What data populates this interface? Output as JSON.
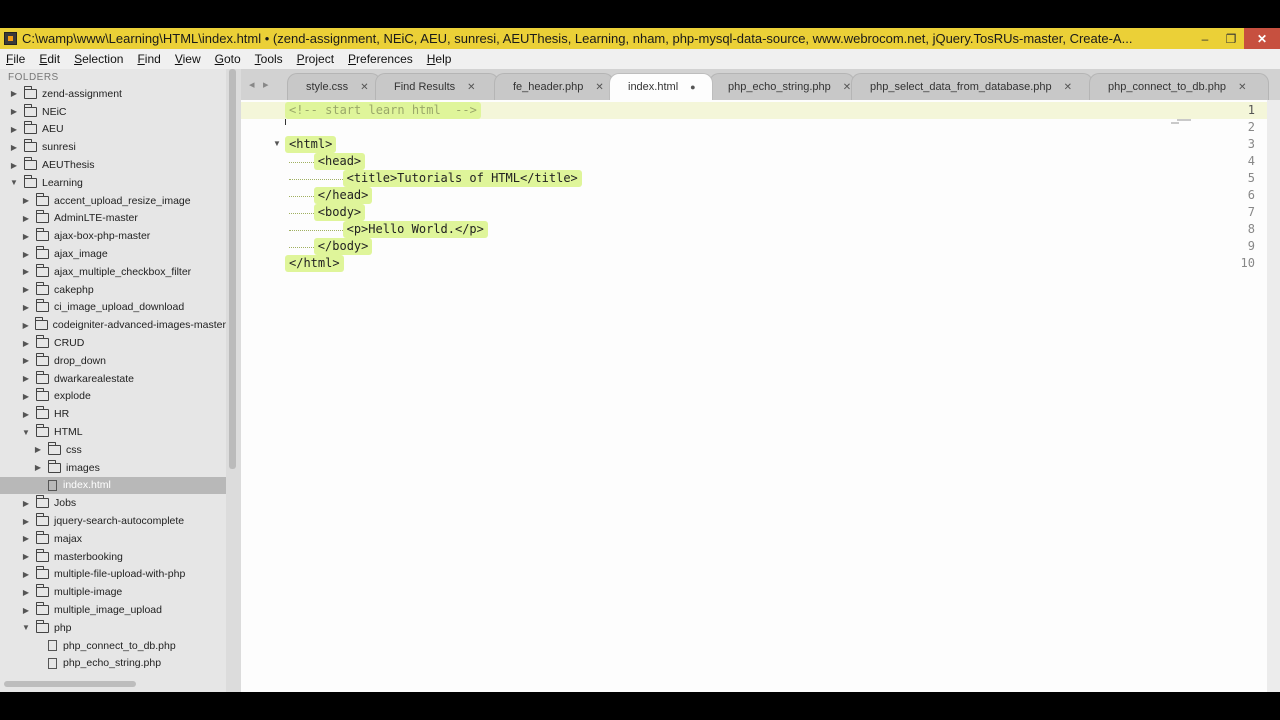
{
  "window": {
    "title": "C:\\wamp\\www\\Learning\\HTML\\index.html • (zend-assignment, NEiC, AEU, sunresi, AEUThesis, Learning, nham, php-mysql-data-source, www.webrocom.net, jQuery.TosRUs-master, Create-A...",
    "controls": {
      "minimize": "–",
      "maximize": "❐",
      "close": "✕"
    },
    "accent_color": "#ebd037"
  },
  "menu": [
    "File",
    "Edit",
    "Selection",
    "Find",
    "View",
    "Goto",
    "Tools",
    "Project",
    "Preferences",
    "Help"
  ],
  "sidebar": {
    "header": "FOLDERS",
    "items": [
      {
        "label": "zend-assignment",
        "depth": 0,
        "kind": "folder",
        "state": "collapsed"
      },
      {
        "label": "NEiC",
        "depth": 0,
        "kind": "folder",
        "state": "collapsed"
      },
      {
        "label": "AEU",
        "depth": 0,
        "kind": "folder",
        "state": "collapsed"
      },
      {
        "label": "sunresi",
        "depth": 0,
        "kind": "folder",
        "state": "collapsed"
      },
      {
        "label": "AEUThesis",
        "depth": 0,
        "kind": "folder",
        "state": "collapsed"
      },
      {
        "label": "Learning",
        "depth": 0,
        "kind": "folder",
        "state": "expanded"
      },
      {
        "label": "accent_upload_resize_image",
        "depth": 1,
        "kind": "folder",
        "state": "collapsed"
      },
      {
        "label": "AdminLTE-master",
        "depth": 1,
        "kind": "folder",
        "state": "collapsed"
      },
      {
        "label": "ajax-box-php-master",
        "depth": 1,
        "kind": "folder",
        "state": "collapsed"
      },
      {
        "label": "ajax_image",
        "depth": 1,
        "kind": "folder",
        "state": "collapsed"
      },
      {
        "label": "ajax_multiple_checkbox_filter",
        "depth": 1,
        "kind": "folder",
        "state": "collapsed"
      },
      {
        "label": "cakephp",
        "depth": 1,
        "kind": "folder",
        "state": "collapsed"
      },
      {
        "label": "ci_image_upload_download",
        "depth": 1,
        "kind": "folder",
        "state": "collapsed"
      },
      {
        "label": "codeigniter-advanced-images-master",
        "depth": 1,
        "kind": "folder",
        "state": "collapsed"
      },
      {
        "label": "CRUD",
        "depth": 1,
        "kind": "folder",
        "state": "collapsed"
      },
      {
        "label": "drop_down",
        "depth": 1,
        "kind": "folder",
        "state": "collapsed"
      },
      {
        "label": "dwarkarealestate",
        "depth": 1,
        "kind": "folder",
        "state": "collapsed"
      },
      {
        "label": "explode",
        "depth": 1,
        "kind": "folder",
        "state": "collapsed"
      },
      {
        "label": "HR",
        "depth": 1,
        "kind": "folder",
        "state": "collapsed"
      },
      {
        "label": "HTML",
        "depth": 1,
        "kind": "folder",
        "state": "expanded"
      },
      {
        "label": "css",
        "depth": 2,
        "kind": "folder",
        "state": "collapsed"
      },
      {
        "label": "images",
        "depth": 2,
        "kind": "folder",
        "state": "collapsed"
      },
      {
        "label": "index.html",
        "depth": 2,
        "kind": "file",
        "state": "selected"
      },
      {
        "label": "Jobs",
        "depth": 1,
        "kind": "folder",
        "state": "collapsed"
      },
      {
        "label": "jquery-search-autocomplete",
        "depth": 1,
        "kind": "folder",
        "state": "collapsed"
      },
      {
        "label": "majax",
        "depth": 1,
        "kind": "folder",
        "state": "collapsed"
      },
      {
        "label": "masterbooking",
        "depth": 1,
        "kind": "folder",
        "state": "collapsed"
      },
      {
        "label": "multiple-file-upload-with-php",
        "depth": 1,
        "kind": "folder",
        "state": "collapsed"
      },
      {
        "label": "multiple-image",
        "depth": 1,
        "kind": "folder",
        "state": "collapsed"
      },
      {
        "label": "multiple_image_upload",
        "depth": 1,
        "kind": "folder",
        "state": "collapsed"
      },
      {
        "label": "php",
        "depth": 1,
        "kind": "folder",
        "state": "expanded"
      },
      {
        "label": "php_connect_to_db.php",
        "depth": 2,
        "kind": "file",
        "state": ""
      },
      {
        "label": "php_echo_string.php",
        "depth": 2,
        "kind": "file",
        "state": ""
      }
    ]
  },
  "tabs": {
    "nav_prev": "◂",
    "nav_next": "▸",
    "items": [
      {
        "label": "style.css",
        "close": "✕",
        "active": false
      },
      {
        "label": "Find Results",
        "close": "✕",
        "active": false
      },
      {
        "label": "fe_header.php",
        "close": "✕",
        "active": false
      },
      {
        "label": "index.html",
        "close": "●",
        "active": true
      },
      {
        "label": "php_echo_string.php",
        "close": "✕",
        "active": false
      },
      {
        "label": "php_select_data_from_database.php",
        "close": "✕",
        "active": false
      },
      {
        "label": "php_connect_to_db.php",
        "close": "✕",
        "active": false
      }
    ]
  },
  "editor": {
    "current_line": 1,
    "lines": [
      {
        "num": "1",
        "text": "<!-- start learn html  -->",
        "indent": 0,
        "comment": true,
        "fold": false
      },
      {
        "num": "2",
        "text": "",
        "indent": 0,
        "comment": false,
        "fold": false
      },
      {
        "num": "3",
        "text": "<html>",
        "indent": 0,
        "comment": false,
        "fold": true
      },
      {
        "num": "4",
        "text": "<head>",
        "indent": 1,
        "comment": false,
        "fold": false
      },
      {
        "num": "5",
        "text": "<title>Tutorials of HTML</title>",
        "indent": 2,
        "comment": false,
        "fold": false
      },
      {
        "num": "6",
        "text": "</head>",
        "indent": 1,
        "comment": false,
        "fold": false
      },
      {
        "num": "7",
        "text": "<body>",
        "indent": 1,
        "comment": false,
        "fold": false
      },
      {
        "num": "8",
        "text": "<p>Hello World.</p>",
        "indent": 2,
        "comment": false,
        "fold": false
      },
      {
        "num": "9",
        "text": "</body>",
        "indent": 1,
        "comment": false,
        "fold": false
      },
      {
        "num": "10",
        "text": "</html>",
        "indent": 0,
        "comment": false,
        "fold": false
      }
    ],
    "highlight_color": "#dff59a"
  }
}
